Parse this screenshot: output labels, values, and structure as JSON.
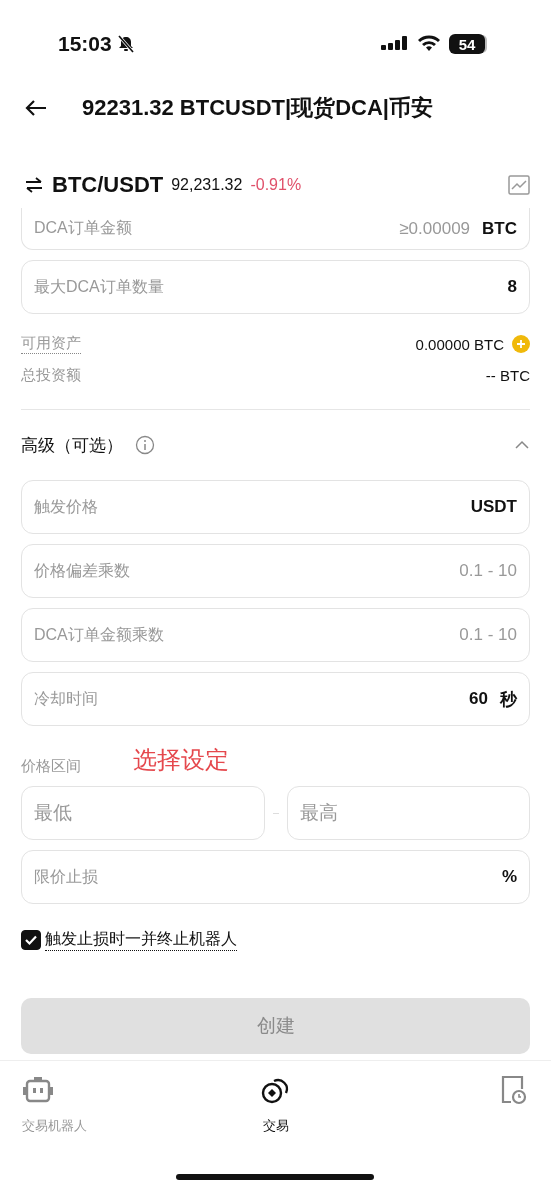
{
  "status_bar": {
    "time": "15:03",
    "battery": "54"
  },
  "header": {
    "title": "92231.32 BTCUSDT|现货DCA|币安"
  },
  "pair": {
    "symbol": "BTC/USDT",
    "price": "92,231.32",
    "change": "-0.91%"
  },
  "fields_top": [
    {
      "placeholder": "DCA订单金额",
      "hint": "≥0.00009",
      "unit": "BTC",
      "cut": true
    },
    {
      "placeholder": "最大DCA订单数量",
      "value": "8",
      "cut": false
    }
  ],
  "balances": [
    {
      "label": "可用资产",
      "value": "0.00000 BTC",
      "add": true,
      "dotted": true
    },
    {
      "label": "总投资额",
      "value": "-- BTC",
      "add": false,
      "dotted": false
    }
  ],
  "advanced": {
    "title": "高级（可选）",
    "expanded": true
  },
  "fields_adv": [
    {
      "placeholder": "触发价格",
      "unit": "USDT"
    },
    {
      "placeholder": "价格偏差乘数",
      "hint": "0.1 - 10"
    },
    {
      "placeholder": "DCA订单金额乘数",
      "hint": "0.1 - 10"
    },
    {
      "placeholder": "冷却时间",
      "value": "60",
      "unit": "秒"
    }
  ],
  "price_range": {
    "label": "价格区间",
    "annotation": "选择设定",
    "min_placeholder": "最低",
    "max_placeholder": "最高"
  },
  "stop_loss": {
    "placeholder": "限价止损",
    "unit": "%"
  },
  "stop_bot": {
    "label": "触发止损时一并终止机器人",
    "checked": true
  },
  "create_button": {
    "label": "创建",
    "disabled": true
  },
  "tabs": [
    {
      "label": "交易机器人",
      "kind": "robot",
      "selected": false
    },
    {
      "label": "交易",
      "kind": "coins",
      "selected": true
    },
    {
      "kind": "history",
      "selected": false
    }
  ]
}
